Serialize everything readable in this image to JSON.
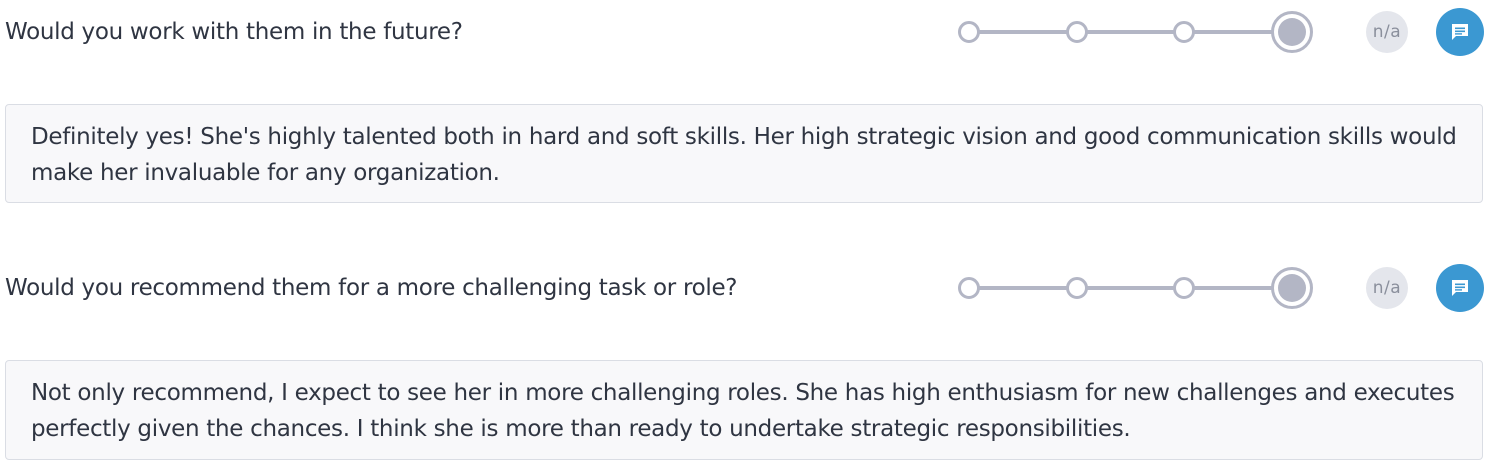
{
  "questions": [
    {
      "question": "Would you work with them in the future?",
      "rating": {
        "steps": 4,
        "selected_step": 4
      },
      "na_label": "n/a",
      "comment_icon": "comment-icon",
      "answer": "Definitely yes! She's highly talented both in hard and soft skills. Her high strategic vision and good communication skills would make her invaluable for any organization."
    },
    {
      "question": "Would you recommend them for a more challenging task or role?",
      "rating": {
        "steps": 4,
        "selected_step": 4
      },
      "na_label": "n/a",
      "comment_icon": "comment-icon",
      "answer": "Not only recommend, I expect to see her in more challenging roles. She has high enthusiasm for new challenges and executes perfectly given the chances. I think she is more than ready to undertake strategic responsibilities."
    }
  ],
  "colors": {
    "track": "#b3b6c5",
    "na_bg": "#e4e6ec",
    "comment_bg": "#3b98d2",
    "answer_bg": "#f8f8fa",
    "answer_border": "#dadde4",
    "text": "#2f3542"
  }
}
